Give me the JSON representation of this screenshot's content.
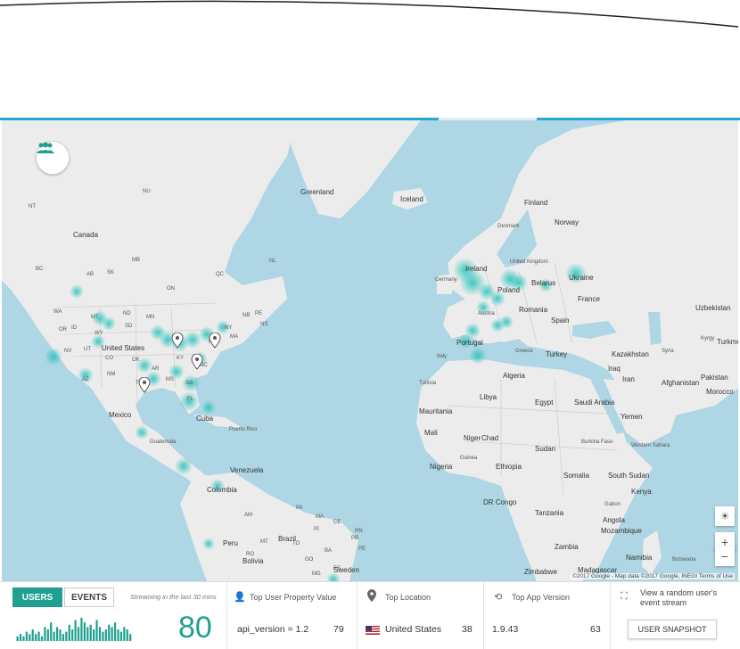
{
  "map": {
    "ocean_color": "#aed6e4",
    "land_color": "#ececec",
    "heat_color": "#3fd0c9",
    "labels": [
      {
        "text": "Greenland",
        "cls": "country"
      },
      {
        "text": "Iceland",
        "cls": "country"
      },
      {
        "text": "Canada",
        "cls": "country"
      },
      {
        "text": "NU",
        "cls": "sm"
      },
      {
        "text": "NT",
        "cls": "sm"
      },
      {
        "text": "BC",
        "cls": "sm"
      },
      {
        "text": "AB",
        "cls": "sm"
      },
      {
        "text": "SK",
        "cls": "sm"
      },
      {
        "text": "MB",
        "cls": "sm"
      },
      {
        "text": "ON",
        "cls": "sm"
      },
      {
        "text": "QC",
        "cls": "sm"
      },
      {
        "text": "NL",
        "cls": "sm"
      },
      {
        "text": "WA",
        "cls": "sm"
      },
      {
        "text": "MT",
        "cls": "sm"
      },
      {
        "text": "ND",
        "cls": "sm"
      },
      {
        "text": "OR",
        "cls": "sm"
      },
      {
        "text": "ID",
        "cls": "sm"
      },
      {
        "text": "WY",
        "cls": "sm"
      },
      {
        "text": "SD",
        "cls": "sm"
      },
      {
        "text": "MN",
        "cls": "sm"
      },
      {
        "text": "United States",
        "cls": "country"
      },
      {
        "text": "NV",
        "cls": "sm"
      },
      {
        "text": "UT",
        "cls": "sm"
      },
      {
        "text": "CO",
        "cls": "sm"
      },
      {
        "text": "NM",
        "cls": "sm"
      },
      {
        "text": "AZ",
        "cls": "sm"
      },
      {
        "text": "TX",
        "cls": "sm"
      },
      {
        "text": "OK",
        "cls": "sm"
      },
      {
        "text": "AR",
        "cls": "sm"
      },
      {
        "text": "MS",
        "cls": "sm"
      },
      {
        "text": "GA",
        "cls": "sm"
      },
      {
        "text": "FL",
        "cls": "sm"
      },
      {
        "text": "NC",
        "cls": "sm"
      },
      {
        "text": "KY",
        "cls": "sm"
      },
      {
        "text": "PA",
        "cls": "sm"
      },
      {
        "text": "NY",
        "cls": "sm"
      },
      {
        "text": "NB",
        "cls": "sm"
      },
      {
        "text": "PE",
        "cls": "sm"
      },
      {
        "text": "NS",
        "cls": "sm"
      },
      {
        "text": "MA",
        "cls": "sm"
      },
      {
        "text": "Mexico",
        "cls": "country"
      },
      {
        "text": "Cuba",
        "cls": "country"
      },
      {
        "text": "Puerto Rico",
        "cls": "sm"
      },
      {
        "text": "Guatemala",
        "cls": "sm"
      },
      {
        "text": "Venezuela",
        "cls": "country"
      },
      {
        "text": "Colombia",
        "cls": "country"
      },
      {
        "text": "Peru",
        "cls": "country"
      },
      {
        "text": "Brazil",
        "cls": "country"
      },
      {
        "text": "Bolivia",
        "cls": "country"
      },
      {
        "text": "AM",
        "cls": "sm"
      },
      {
        "text": "PA",
        "cls": "sm"
      },
      {
        "text": "MA",
        "cls": "sm"
      },
      {
        "text": "CE",
        "cls": "sm"
      },
      {
        "text": "PI",
        "cls": "sm"
      },
      {
        "text": "RN",
        "cls": "sm"
      },
      {
        "text": "PB",
        "cls": "sm"
      },
      {
        "text": "PE",
        "cls": "sm"
      },
      {
        "text": "TO",
        "cls": "sm"
      },
      {
        "text": "RO",
        "cls": "sm"
      },
      {
        "text": "MT",
        "cls": "sm"
      },
      {
        "text": "BA",
        "cls": "sm"
      },
      {
        "text": "GO",
        "cls": "sm"
      },
      {
        "text": "MG",
        "cls": "sm"
      },
      {
        "text": "ES",
        "cls": "sm"
      },
      {
        "text": "Sweden",
        "cls": "country"
      },
      {
        "text": "Finland",
        "cls": "country"
      },
      {
        "text": "Norway",
        "cls": "country"
      },
      {
        "text": "Denmark",
        "cls": "sm"
      },
      {
        "text": "United Kingdom",
        "cls": "sm"
      },
      {
        "text": "Ireland",
        "cls": "country"
      },
      {
        "text": "Germany",
        "cls": "sm"
      },
      {
        "text": "Poland",
        "cls": "country"
      },
      {
        "text": "Belarus",
        "cls": "country"
      },
      {
        "text": "Ukraine",
        "cls": "country"
      },
      {
        "text": "France",
        "cls": "country"
      },
      {
        "text": "Austria",
        "cls": "sm"
      },
      {
        "text": "Romania",
        "cls": "country"
      },
      {
        "text": "Spain",
        "cls": "country"
      },
      {
        "text": "Portugal",
        "cls": "country"
      },
      {
        "text": "Italy",
        "cls": "sm"
      },
      {
        "text": "Greece",
        "cls": "sm"
      },
      {
        "text": "Turkey",
        "cls": "country"
      },
      {
        "text": "Kazakhstan",
        "cls": "country"
      },
      {
        "text": "Uzbekistan",
        "cls": "country"
      },
      {
        "text": "Kyrgy",
        "cls": "sm"
      },
      {
        "text": "Turkmenistan",
        "cls": "country"
      },
      {
        "text": "Syria",
        "cls": "sm"
      },
      {
        "text": "Iraq",
        "cls": "country"
      },
      {
        "text": "Iran",
        "cls": "country"
      },
      {
        "text": "Afghanistan",
        "cls": "country"
      },
      {
        "text": "Pakistan",
        "cls": "country"
      },
      {
        "text": "Morocco",
        "cls": "country"
      },
      {
        "text": "Tunisia",
        "cls": "sm"
      },
      {
        "text": "Algeria",
        "cls": "country"
      },
      {
        "text": "Libya",
        "cls": "country"
      },
      {
        "text": "Egypt",
        "cls": "country"
      },
      {
        "text": "Saudi Arabia",
        "cls": "country"
      },
      {
        "text": "Yemen",
        "cls": "country"
      },
      {
        "text": "Western Sahara",
        "cls": "sm"
      },
      {
        "text": "Mauritania",
        "cls": "country"
      },
      {
        "text": "Mali",
        "cls": "country"
      },
      {
        "text": "Niger",
        "cls": "country"
      },
      {
        "text": "Chad",
        "cls": "country"
      },
      {
        "text": "Sudan",
        "cls": "country"
      },
      {
        "text": "Burkina Faso",
        "cls": "sm"
      },
      {
        "text": "Guinea",
        "cls": "sm"
      },
      {
        "text": "Nigeria",
        "cls": "country"
      },
      {
        "text": "Ethiopia",
        "cls": "country"
      },
      {
        "text": "South Sudan",
        "cls": "country"
      },
      {
        "text": "Somalia",
        "cls": "country"
      },
      {
        "text": "Kenya",
        "cls": "country"
      },
      {
        "text": "Gabon",
        "cls": "sm"
      },
      {
        "text": "DR Congo",
        "cls": "country"
      },
      {
        "text": "Tanzania",
        "cls": "country"
      },
      {
        "text": "Angola",
        "cls": "country"
      },
      {
        "text": "Zambia",
        "cls": "country"
      },
      {
        "text": "Mozambique",
        "cls": "country"
      },
      {
        "text": "Namibia",
        "cls": "country"
      },
      {
        "text": "Zimbabwe",
        "cls": "country"
      },
      {
        "text": "Madagascar",
        "cls": "country"
      },
      {
        "text": "Botswana",
        "cls": "sm"
      }
    ],
    "credit": "©2017 Google - Map data ©2017 Google, INEGI   Terms of Use",
    "zoom_in": "+",
    "zoom_out": "−"
  },
  "bottom": {
    "tab_users": "USERS",
    "tab_events": "EVENTS",
    "streaming": "Streaming in the last 30 mins",
    "active_users": "80",
    "sparkline": [
      2,
      3,
      2,
      4,
      3,
      5,
      3,
      4,
      2,
      6,
      5,
      8,
      4,
      6,
      5,
      3,
      4,
      7,
      5,
      9,
      6,
      10,
      8,
      6,
      7,
      5,
      9,
      6,
      4,
      5,
      7,
      6,
      8,
      5,
      4,
      6,
      5,
      3
    ],
    "property_title": "Top User Property Value",
    "property_value": "api_version = 1.2",
    "property_count": "79",
    "location_title": "Top Location",
    "location_value": "United States",
    "location_count": "38",
    "version_title": "Top App Version",
    "version_value": "1.9.43",
    "version_count": "63",
    "snapshot_text": "View a random user's event stream",
    "snapshot_button": "USER SNAPSHOT"
  }
}
